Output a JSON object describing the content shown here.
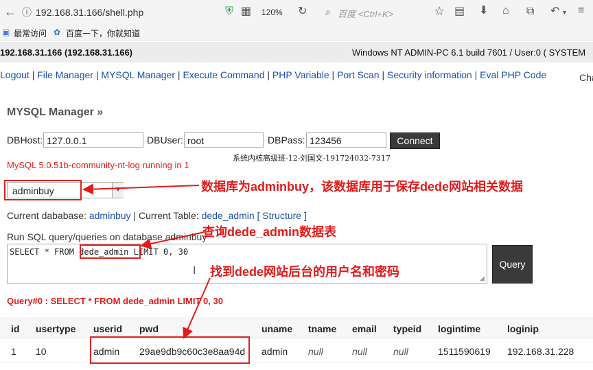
{
  "browser": {
    "url": "192.168.31.166/shell.php",
    "zoom": "120%",
    "search_placeholder": "百度 <Ctrl+K>",
    "bookmarks": [
      "最常访问",
      "百度一下，你就知道"
    ]
  },
  "system": {
    "host": "192.168.31.166 (192.168.31.166)",
    "os_info": "Windows NT ADMIN-PC 6.1 build 7601 / User:0 ( SYSTEM"
  },
  "nav": {
    "items": [
      "Logout",
      "File Manager",
      "MYSQL Manager",
      "Execute Command",
      "PHP Variable",
      "Port Scan",
      "Security information",
      "Eval PHP Code"
    ],
    "right_text": "Cha"
  },
  "mysql": {
    "section_title": "MYSQL Manager »",
    "dbhost_label": "DBHost:",
    "dbhost_value": "127.0.0.1",
    "dbuser_label": "DBUser:",
    "dbuser_value": "root",
    "dbpass_label": "DBPass:",
    "dbpass_value": "123456",
    "connect_label": "Connect",
    "watermark": "系统内核高级班-12-刘国文-191724032-7317",
    "status": "MySQL 5.0.51b-community-nt-log running in 1",
    "database_select": "adminbuy",
    "current_db_label": "Current dababase:",
    "current_db": "adminbuy",
    "current_table_label": "| Current Table:",
    "current_table": "dede_admin",
    "structure_link": "[ Structure ]",
    "run_label": "Run SQL query/queries on database adminbuy",
    "query_prefix": "SELECT * FROM ",
    "query_table": "dede_admin",
    "query_suffix": " LIMIT 0, 30",
    "query_button": "Query",
    "query_result_title": "Query#0 : SELECT * FROM dede_admin LIMIT 0, 30"
  },
  "annotations": {
    "db_note": "数据库为adminbuy，该数据库用于保存dede网站相关数据",
    "table_note": "查询dede_admin数据表",
    "user_note": "找到dede网站后台的用户名和密码"
  },
  "table": {
    "headers": [
      "id",
      "usertype",
      "userid",
      "pwd",
      "uname",
      "tname",
      "email",
      "typeid",
      "logintime",
      "loginip"
    ],
    "row": [
      "1",
      "10",
      "admin",
      "29ae9db9c60c3e8aa94d",
      "admin",
      "null",
      "null",
      "null",
      "1511590619",
      "192.168.31.228"
    ]
  },
  "colors": {
    "accent_red": "#e31b1b",
    "link_blue": "#1a4fae",
    "button_dark": "#3a3a3a"
  }
}
